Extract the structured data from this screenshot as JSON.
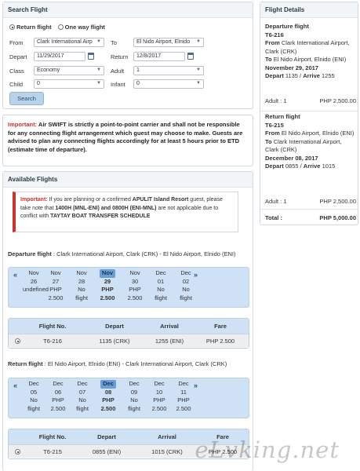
{
  "search": {
    "title": "Search Flight",
    "return_label": "Return flight",
    "oneway_label": "One way flight",
    "from_label": "From",
    "from_value": "Clark International Airp",
    "to_label": "To",
    "to_value": "El Nido Airport, Elnido",
    "depart_label": "Depart",
    "depart_value": "11/29/2017",
    "return_field_label": "Return",
    "return_value": "12/8/2017",
    "class_label": "Class",
    "class_value": "Economy",
    "adult_label": "Adult",
    "adult_value": "1",
    "child_label": "Child",
    "child_value": "0",
    "infant_label": "Infant",
    "infant_value": "0",
    "button": "Search"
  },
  "important": {
    "label": "Important:",
    "text": " Air SWIFT is strictly a point-to-point carrier and shall not be responsible for any connecting flight arrangement which guest may choose to make. Guests are advised to plan any connecting flights accordingly for at least 5 hours prior to ETD (estimate time of departure)."
  },
  "available": {
    "title": "Available Flights",
    "notice": {
      "label": "Important:",
      "t1": " If you are planning or a confirmed ",
      "resort": "APULIT Island Resort",
      "t2": " guest, please take note that ",
      "flights": "1400H (MNL-ENI) and 0800H (ENI-MNL)",
      "t3": " are not applicable due to conflict with ",
      "schedule": "TAYTAY BOAT TRANSFER SCHEDULE"
    },
    "departure": {
      "label": "Departure flight",
      "route": " : Clark International Airport, Clark (CRK) - El Nido Airport, Elnido (ENI)",
      "days": [
        {
          "m": "Nov",
          "d": "26",
          "a": "undefined",
          "b": ""
        },
        {
          "m": "Nov",
          "d": "27",
          "a": "PHP",
          "b": "2.500"
        },
        {
          "m": "Nov",
          "d": "28",
          "a": "No",
          "b": "flight"
        },
        {
          "m": "Nov",
          "d": "29",
          "a": "PHP",
          "b": "2.500"
        },
        {
          "m": "Nov",
          "d": "30",
          "a": "PHP",
          "b": "2.500"
        },
        {
          "m": "Dec",
          "d": "01",
          "a": "No",
          "b": "flight"
        },
        {
          "m": "Dec",
          "d": "02",
          "a": "No",
          "b": "flight"
        }
      ],
      "headers": [
        "Flight No.",
        "Depart",
        "Arrival",
        "Fare"
      ],
      "row": [
        "T6-216",
        "1135 (CRK)",
        "1255 (ENI)",
        "PHP 2.500"
      ]
    },
    "return": {
      "label": "Return flight",
      "route": " : El Nido Airport, Elnido (ENI) - Clark International Airport, Clark (CRK)",
      "days": [
        {
          "m": "Dec",
          "d": "05",
          "a": "No",
          "b": "flight"
        },
        {
          "m": "Dec",
          "d": "06",
          "a": "PHP",
          "b": "2.500"
        },
        {
          "m": "Dec",
          "d": "07",
          "a": "No",
          "b": "flight"
        },
        {
          "m": "Dec",
          "d": "08",
          "a": "PHP",
          "b": "2.500"
        },
        {
          "m": "Dec",
          "d": "09",
          "a": "No",
          "b": "flight"
        },
        {
          "m": "Dec",
          "d": "10",
          "a": "PHP",
          "b": "2.500"
        },
        {
          "m": "Dec",
          "d": "11",
          "a": "PHP",
          "b": "2.500"
        }
      ],
      "headers": [
        "Flight No.",
        "Depart",
        "Arrival",
        "Fare"
      ],
      "row": [
        "T6-215",
        "0855 (ENI)",
        "1015 (CRK)",
        "PHP 2.500"
      ]
    },
    "prev": "«",
    "next": "»"
  },
  "details": {
    "title": "Flight Details",
    "dep_title": "Departure flight",
    "dep_no": "T6-216",
    "from_label": "From",
    "dep_from": " Clark International Airport, Clark (CRK)",
    "to_label": "To",
    "dep_to": " El Nido Airport, Elnido (ENI)",
    "dep_date": "November 29, 2017",
    "depart_label": "Depart",
    "dep_depart": " 1135 / ",
    "arrive_label": "Arrive",
    "dep_arrive": " 1255",
    "dep_pax": "Adult : 1",
    "dep_price": "PHP 2,500.00",
    "ret_title": "Return flight",
    "ret_no": "T6-215",
    "ret_from": " El Nido Airport, Elnido (ENI)",
    "ret_to": " Clark International Airport, Clark (CRK)",
    "ret_date": "December 08, 2017",
    "ret_depart": " 0855 / ",
    "ret_arrive": " 1015",
    "ret_pax": "Adult : 1",
    "ret_price": "PHP 2,500.00",
    "total_label": "Total :",
    "total_value": "PHP 5,000.00"
  },
  "watermark": "eLvking.net"
}
